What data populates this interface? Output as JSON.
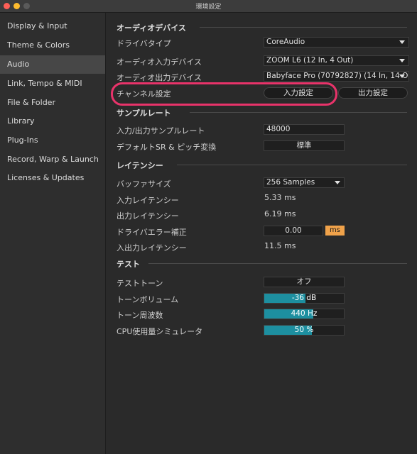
{
  "window": {
    "title": "環境設定"
  },
  "sidebar": {
    "items": [
      {
        "label": "Display & Input"
      },
      {
        "label": "Theme & Colors"
      },
      {
        "label": "Audio",
        "active": true
      },
      {
        "label": "Link, Tempo & MIDI"
      },
      {
        "label": "File & Folder"
      },
      {
        "label": "Library"
      },
      {
        "label": "Plug-Ins"
      },
      {
        "label": "Record, Warp & Launch"
      },
      {
        "label": "Licenses & Updates"
      }
    ]
  },
  "audio_device": {
    "heading": "オーディオデバイス",
    "driver_type_label": "ドライバタイプ",
    "driver_type_value": "CoreAudio",
    "input_device_label": "オーディオ入力デバイス",
    "input_device_value": "ZOOM L6 (12 In, 4 Out)",
    "output_device_label": "オーディオ出力デバイス",
    "output_device_value": "Babyface Pro (70792827) (14 In, 14 O",
    "channel_label": "チャンネル設定",
    "input_config_button": "入力設定",
    "output_config_button": "出力設定"
  },
  "sample_rate": {
    "heading": "サンプルレート",
    "rate_label": "入力/出力サンプルレート",
    "rate_value": "48000",
    "default_sr_label": "デフォルトSR & ピッチ変換",
    "default_sr_value": "標準"
  },
  "latency": {
    "heading": "レイテンシー",
    "buffer_label": "バッファサイズ",
    "buffer_value": "256 Samples",
    "input_latency_label": "入力レイテンシー",
    "input_latency_value": "5.33 ms",
    "output_latency_label": "出力レイテンシー",
    "output_latency_value": "6.19 ms",
    "driver_error_label": "ドライバエラー補正",
    "driver_error_value": "0.00",
    "driver_error_unit": "ms",
    "io_latency_label": "入出力レイテンシー",
    "io_latency_value": "11.5 ms"
  },
  "test": {
    "heading": "テスト",
    "tone_label": "テストトーン",
    "tone_value": "オフ",
    "volume_label": "トーンボリューム",
    "volume_value": "-36 dB",
    "frequency_label": "トーン周波数",
    "frequency_value": "440 Hz",
    "cpu_label": "CPU使用量シミュレータ",
    "cpu_value": "50 %"
  },
  "colors": {
    "highlight_ring": "#e8336a",
    "slider_fill": "#1d8fa0",
    "ms_badge": "#f0a24a"
  }
}
